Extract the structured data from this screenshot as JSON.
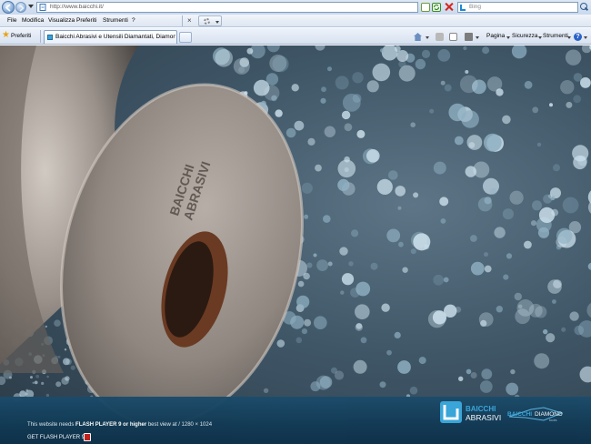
{
  "browser": {
    "url": "http://www.baicchi.it/",
    "search_placeholder": "Bing",
    "menu": [
      "File",
      "Modifica",
      "Visualizza",
      "Preferiti",
      "Strumenti",
      "?"
    ],
    "favorites_label": "Preferiti",
    "tab_title": "Baicchi Abrasivi e Utensili Diamantati, Diamond Tools f...",
    "commandbar": {
      "page": "Pagina",
      "safety": "Sicurezza",
      "tools": "Strumenti",
      "help_symbol": "?"
    },
    "stop_symbol": "×"
  },
  "page": {
    "wheel_engraving": {
      "top": "BAICCHI",
      "bottom": "ABRASIVI"
    },
    "footer": {
      "flash_notice_prefix": "This website needs",
      "flash_notice_required": "FLASH PLAYER 9 or higher",
      "flash_notice_suffix": "best view at / 1280 × 1024",
      "get_flash": "GET FLASH PLAYER 9",
      "logo_main": {
        "line1": "BAICCHI",
        "line2": "ABRASIVI",
        "color_primary": "#3aa8dd",
        "color_secondary": "#ffffff"
      },
      "logo_secondary": {
        "word1": "BAICCHI",
        "word2": "DIAMOND",
        "word3": "tools"
      }
    }
  },
  "colors": {
    "chrome_top": "#dfe9f5",
    "footer_band": "#143f5c",
    "accent": "#3aa8dd"
  }
}
